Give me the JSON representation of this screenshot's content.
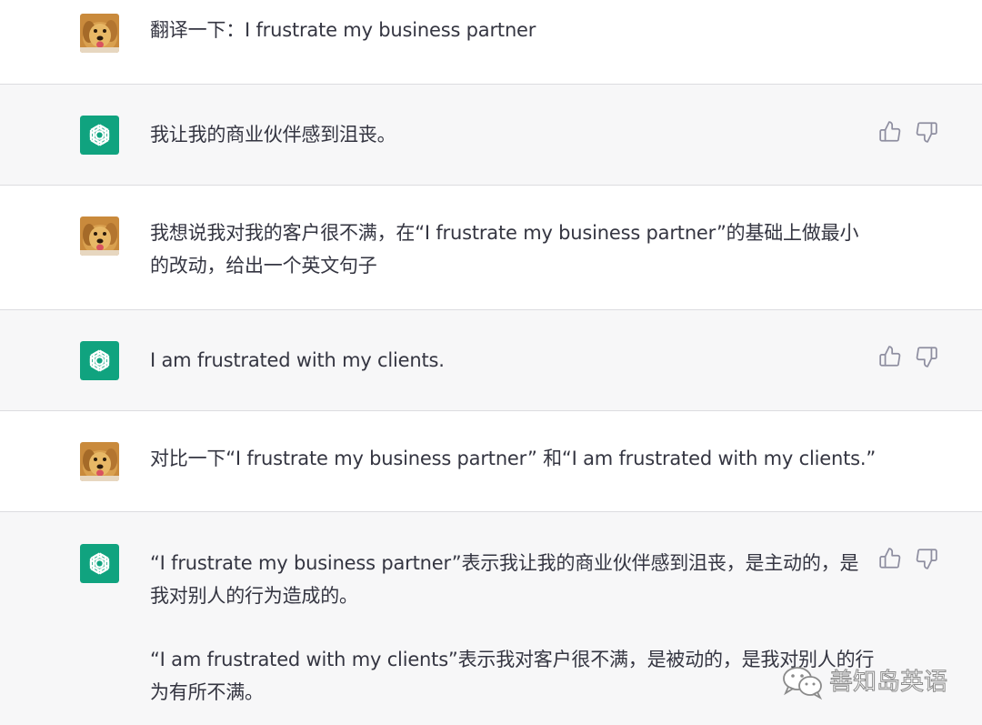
{
  "conversation": {
    "messages": [
      {
        "role": "user",
        "paragraphs": [
          "翻译一下：I frustrate my business partner"
        ]
      },
      {
        "role": "assistant",
        "paragraphs": [
          "我让我的商业伙伴感到沮丧。"
        ]
      },
      {
        "role": "user",
        "paragraphs": [
          "我想说我对我的客户很不满，在“I frustrate my business partner”的基础上做最小的改动，给出一个英文句子"
        ]
      },
      {
        "role": "assistant",
        "paragraphs": [
          "I am frustrated with my clients."
        ]
      },
      {
        "role": "user",
        "paragraphs": [
          "对比一下“I frustrate my business partner” 和“I am frustrated with my clients.”"
        ]
      },
      {
        "role": "assistant",
        "paragraphs": [
          "“I frustrate my business partner”表示我让我的商业伙伴感到沮丧，是主动的，是我对别人的行为造成的。",
          "“I am frustrated with my clients”表示我对客户很不满，是被动的，是我对别人的行为有所不满。"
        ]
      }
    ]
  },
  "icons": {
    "user_avatar": "golden-retriever-avatar",
    "assistant_avatar": "openai-logo-icon",
    "feedback_up": "thumbs-up-icon",
    "feedback_down": "thumbs-down-icon",
    "watermark": "wechat-icon"
  },
  "colors": {
    "assistant_background": "#f7f7f8",
    "user_background": "#ffffff",
    "assistant_logo": "#10a37f",
    "text": "#343541"
  },
  "watermark": {
    "text": "善知岛英语"
  }
}
